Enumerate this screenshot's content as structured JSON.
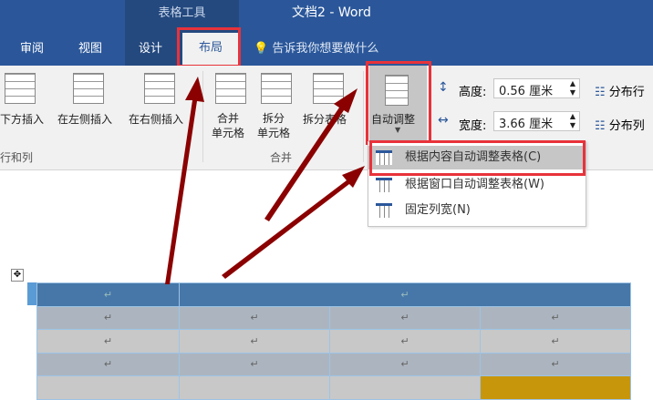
{
  "window": {
    "context_tab_group": "表格工具",
    "title": "文档2  -  Word"
  },
  "tabs": [
    {
      "label": "审阅"
    },
    {
      "label": "视图"
    },
    {
      "label": "设计"
    },
    {
      "label": "布局",
      "selected": true
    }
  ],
  "tell_me": "告诉我你想要做什么",
  "ribbon": {
    "rows_cols": {
      "buttons": [
        "下方插入",
        "在左侧插入",
        "在右侧插入"
      ],
      "group_label": "行和列"
    },
    "merge": {
      "buttons": [
        "合并\n单元格",
        "拆分\n单元格",
        "拆分表格"
      ],
      "group_label": "合并"
    },
    "autofit": {
      "label": "自动调整"
    },
    "height": {
      "label": "高度:",
      "value": "0.56 厘米"
    },
    "width": {
      "label": "宽度:",
      "value": "3.66 厘米"
    },
    "distribute_rows": "分布行",
    "distribute_cols": "分布列"
  },
  "autofit_menu": [
    {
      "label": "根据内容自动调整表格(C)",
      "highlighted": true
    },
    {
      "label": "根据窗口自动调整表格(W)"
    },
    {
      "label": "固定列宽(N)"
    }
  ],
  "table": {
    "paragraph_mark": "↵",
    "rows": 5,
    "cols": 4
  },
  "colors": {
    "title_bar": "#2b579a",
    "highlight_box": "#e8323a",
    "arrow": "#8b0000",
    "selected_row": "#4677a8"
  }
}
